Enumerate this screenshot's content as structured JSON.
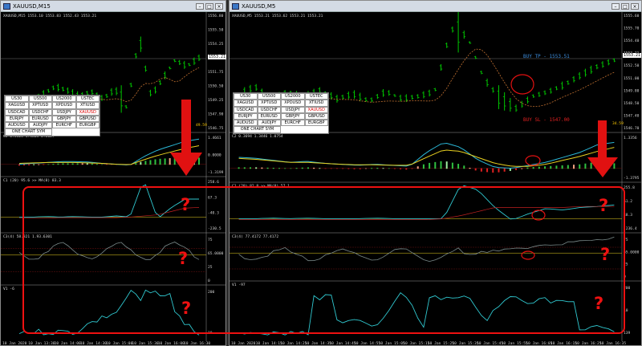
{
  "left_window": {
    "title": "XAUUSD,M15",
    "ohlc": "XAUUSD,M15 1553.10 1553.83 1552.43 1553.21",
    "price_labels": [
      "1556.80",
      "1555.50",
      "1554.25",
      "1553.21",
      "1551.75",
      "1550.50",
      "1549.25",
      "1547.90",
      "1546.75"
    ],
    "macd_header": "C2 0.5323 1.3863 0.8629",
    "macd_labels": [
      "1.4661",
      "0.0000",
      "-1.3199"
    ],
    "macd_left_value": "49.59",
    "cci_header": "C1 (20) 95.6  >> MA(8) 83.3",
    "cci_labels": [
      "258.6",
      "67.3",
      "-40.3",
      "-230.5"
    ],
    "stoch_header": "C3(4) 58.821 1.93.6301",
    "stoch_labels": [
      "75",
      "65.0000",
      "25",
      "0"
    ],
    "volume_header": "V1 -6",
    "volume_labels": [
      "200",
      "10"
    ],
    "time_labels": [
      "10 Jan 2020",
      "10 Jan 13:30",
      "10 Jan 14:00",
      "10 Jan 14:30",
      "10 Jan 15:00",
      "10 Jan 15:30",
      "10 Jan 16:00",
      "10 Jan 16:30"
    ]
  },
  "right_window": {
    "title": "XAUUSD,M5",
    "ohlc": "XAUUSD,M5 1553.21 1553.62 1553.21 1553.21",
    "price_labels": [
      "1555.60",
      "1555.70",
      "1554.40",
      "1553.21",
      "1552.50",
      "1551.00",
      "1549.80",
      "1548.50",
      "1547.40",
      "1546.70"
    ],
    "buy_tp": "BUY TP - 1553.51",
    "buy_sl": "BUY SL - 1547.00",
    "right_value": "34.59",
    "macd_header": "C2 0.3694 1.3446 1.0754",
    "macd_labels": [
      "1.3356",
      "-1.3795"
    ],
    "cci_header": "C1 (20) 82.8  >> MA(8) 57.1",
    "cci_labels": [
      "255.8",
      "61.2",
      "48.3",
      "-236.4"
    ],
    "stoch_header": "C3(4) 77.4172 77.4172",
    "stoch_labels": [
      "75",
      "65.0000",
      "25",
      "0"
    ],
    "volume_header": "V1 -97",
    "volume_labels": [
      "200",
      "10",
      "139"
    ],
    "time_labels": [
      "10 Jan 2020",
      "10 Jan 14:15",
      "10 Jan 14:25",
      "10 Jan 14:35",
      "10 Jan 14:45",
      "10 Jan 14:55",
      "10 Jan 15:05",
      "10 Jan 15:15",
      "10 Jan 15:25",
      "10 Jan 15:35",
      "10 Jan 15:45",
      "10 Jan 15:55",
      "10 Jan 16:05",
      "10 Jan 16:15",
      "10 Jan 16:25",
      "10 Jan 16:35"
    ]
  },
  "symbol_panel": {
    "rows": [
      [
        "US30",
        "US500",
        "US2000",
        "USTEC"
      ],
      [
        "XAGUSD",
        "XPTUSD",
        "XPDUSD",
        "XTIUSD"
      ],
      [
        "USDCAD",
        "USDCHF",
        "USDJPY",
        "XAUUSD"
      ],
      [
        "EURJPY",
        "EURUSD",
        "GBPJPY",
        "GBPUSD"
      ],
      [
        "AUDUSD",
        "AUDJPY",
        "EURCHF",
        "EURGBP"
      ]
    ],
    "highlight": "XAUUSD",
    "footer": "ONE CHART SYM"
  },
  "annotations": {
    "question_mark": "?"
  },
  "colors": {
    "candle": "#00c800",
    "macd_line": "#2bb8d8",
    "signal_line": "#e8d020",
    "indicator_line": "#30c8d0",
    "ma_line": "#c02020",
    "stoch_line": "#7a8a8a",
    "annotation": "#e11111",
    "buy_tp": "#3d8fe0",
    "buy_sl": "#e02020"
  }
}
